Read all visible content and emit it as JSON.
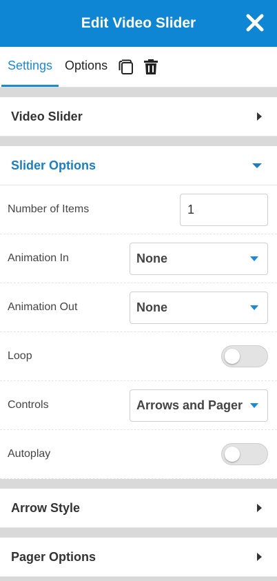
{
  "header": {
    "title": "Edit Video Slider",
    "close_icon": "close-icon"
  },
  "tabs": [
    {
      "label": "Settings",
      "active": true
    },
    {
      "label": "Options",
      "active": false
    }
  ],
  "tab_icons": [
    "duplicate-icon",
    "trash-icon"
  ],
  "sections": {
    "video_slider": {
      "title": "Video Slider",
      "expanded": false
    },
    "slider_options": {
      "title": "Slider Options",
      "expanded": true,
      "fields": {
        "number_of_items": {
          "label": "Number of Items",
          "value": "1"
        },
        "animation_in": {
          "label": "Animation In",
          "value": "None"
        },
        "animation_out": {
          "label": "Animation Out",
          "value": "None"
        },
        "loop": {
          "label": "Loop",
          "on": false
        },
        "controls": {
          "label": "Controls",
          "value": "Arrows and Pager"
        },
        "autoplay": {
          "label": "Autoplay",
          "on": false
        }
      }
    },
    "arrow_style": {
      "title": "Arrow Style",
      "expanded": false
    },
    "pager_options": {
      "title": "Pager Options",
      "expanded": false
    }
  },
  "colors": {
    "header_bg": "#0e86d4",
    "accent": "#1a8ad6",
    "section_open": "#1a7fc0"
  }
}
